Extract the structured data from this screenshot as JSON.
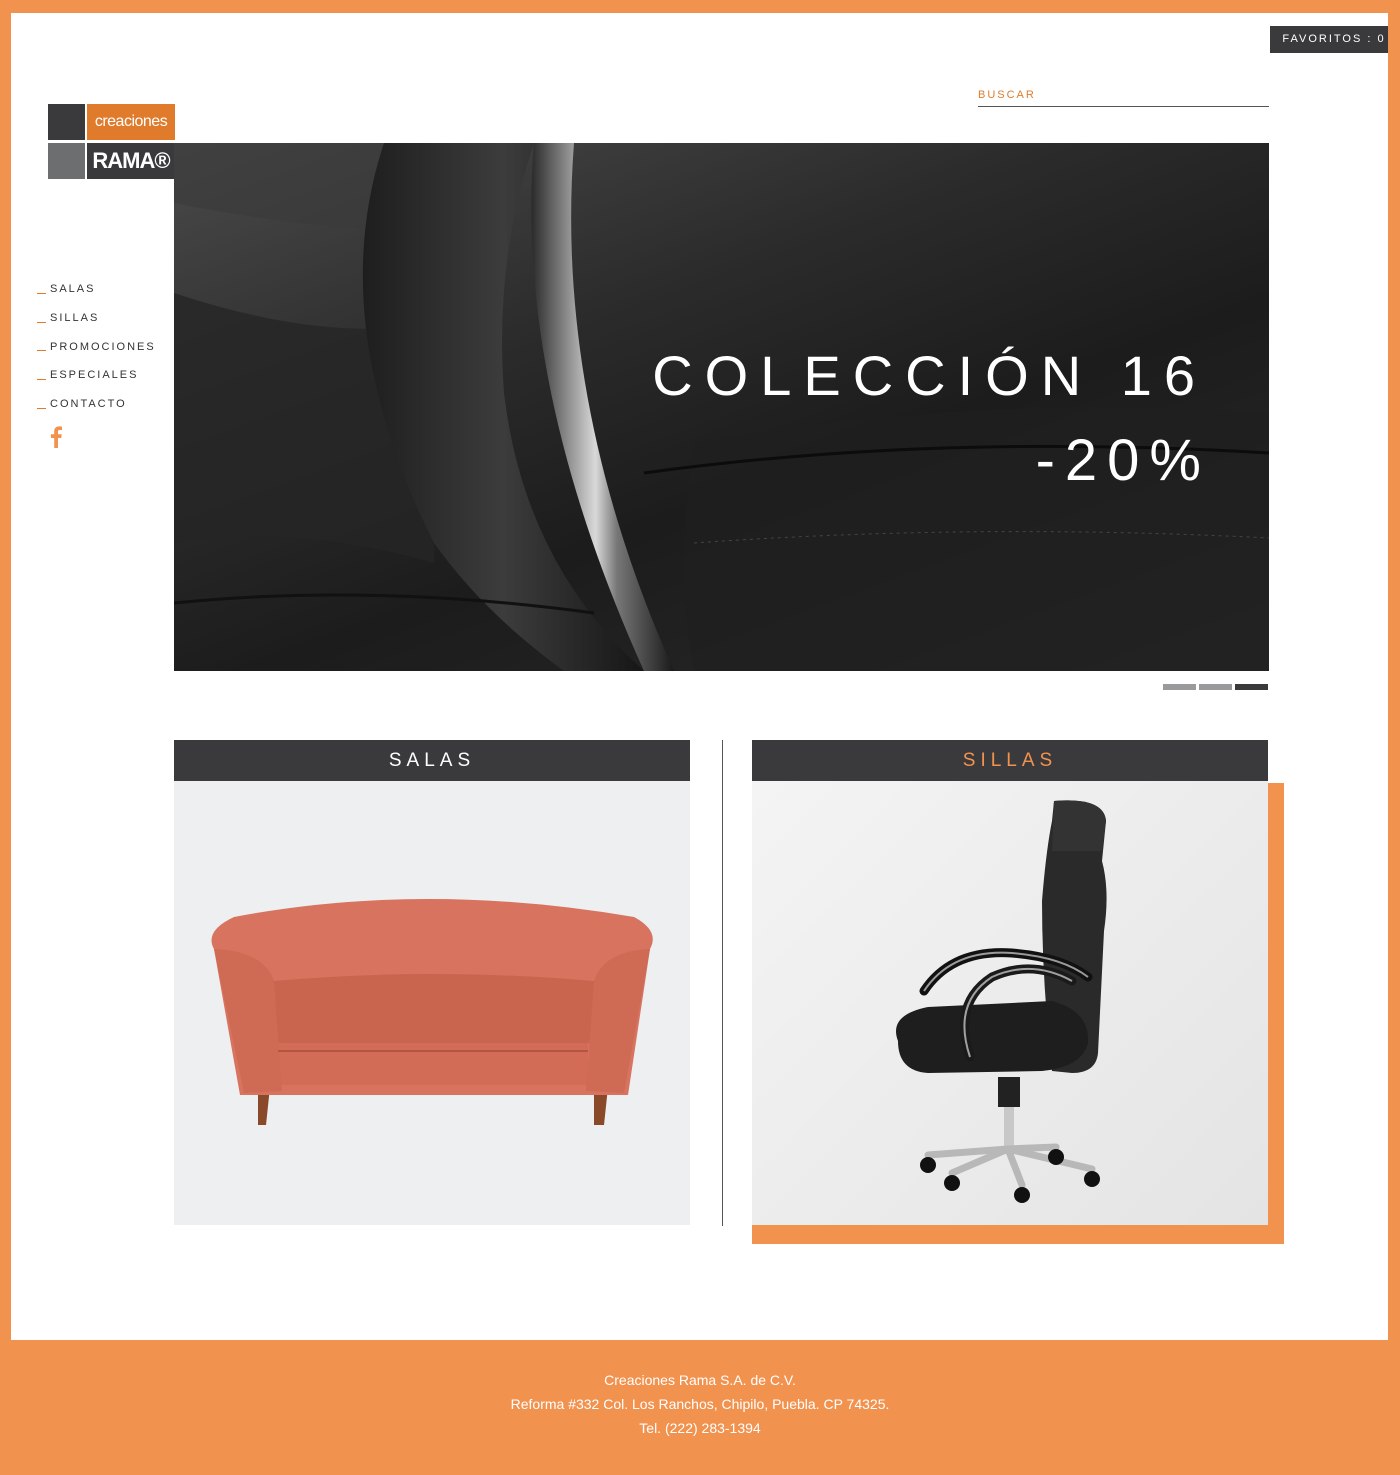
{
  "header": {
    "favorites_label": "FAVORITOS : 0",
    "search_placeholder": "BUSCAR"
  },
  "logo": {
    "word1": "creaciones",
    "word2": "RAMA®"
  },
  "nav": {
    "items": [
      {
        "label": "SALAS"
      },
      {
        "label": "SILLAS"
      },
      {
        "label": "PROMOCIONES"
      },
      {
        "label": "ESPECIALES"
      },
      {
        "label": "CONTACTO"
      }
    ],
    "social_icon": "facebook-icon"
  },
  "hero": {
    "title": "COLECCIÓN 16",
    "subtitle": "-20%",
    "slide_count": 3,
    "active_slide": 3
  },
  "categories": [
    {
      "label": "SALAS",
      "image": "sofa"
    },
    {
      "label": "SILLAS",
      "image": "office-chair"
    }
  ],
  "footer": {
    "line1": "Creaciones Rama S.A. de C.V.",
    "line2": "Reforma #332 Col. Los Ranchos, Chipilo, Puebla. CP 74325.",
    "line3": "Tel. (222) 283-1394"
  },
  "colors": {
    "accent": "#f2924f",
    "dark": "#3a3a3c",
    "gray": "#6d6e70"
  }
}
